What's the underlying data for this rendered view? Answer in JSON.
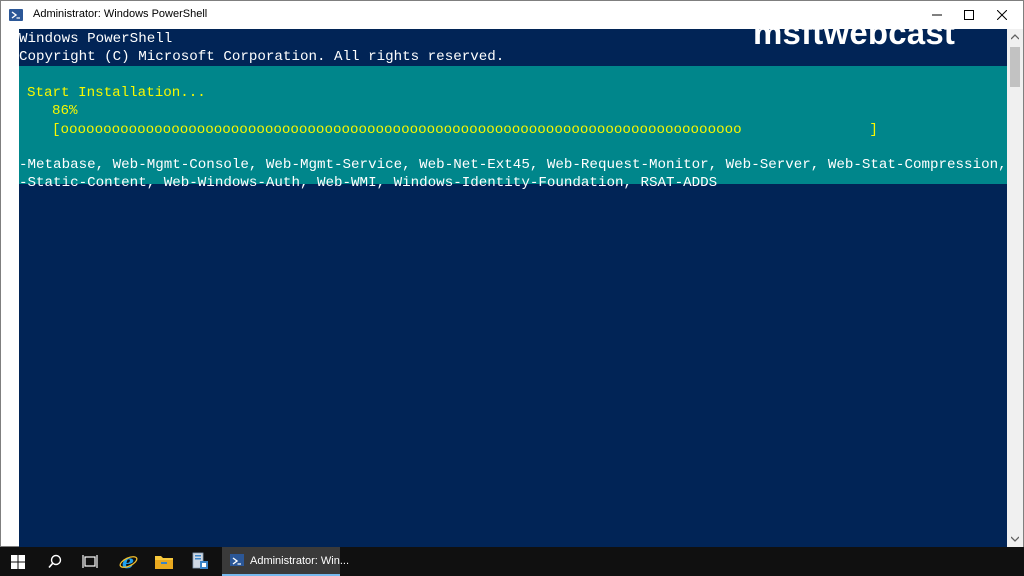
{
  "window": {
    "title": "Administrator: Windows PowerShell",
    "icon": "powershell-icon"
  },
  "console": {
    "lines": [
      "Windows PowerShell",
      "Copyright (C) Microsoft Corporation. All rights reserved."
    ],
    "progress": {
      "activity": "Start Installation...",
      "percent_text": "86%",
      "bar_text": "[oooooooooooooooooooooooooooooooooooooooooooooooooooooooooooooooooooooooooooooooo               ]"
    },
    "output_lines": [
      "-Metabase, Web-Mgmt-Console, Web-Mgmt-Service, Web-Net-Ext45, Web-Request-Monitor, Web-Server, Web-Stat-Compression, Web",
      "-Static-Content, Web-Windows-Auth, Web-WMI, Windows-Identity-Foundation, RSAT-ADDS"
    ]
  },
  "watermark": "msftwebcast",
  "taskbar": {
    "icons": [
      "start-icon",
      "search-icon",
      "task-view-icon",
      "internet-explorer-icon",
      "file-explorer-icon",
      "server-manager-icon"
    ],
    "active_app_label": "Administrator: Win..."
  },
  "colors": {
    "console_bg": "#012456",
    "progress_bg": "#00868b",
    "progress_text": "#f8f800",
    "taskbar_bg": "#101010"
  }
}
